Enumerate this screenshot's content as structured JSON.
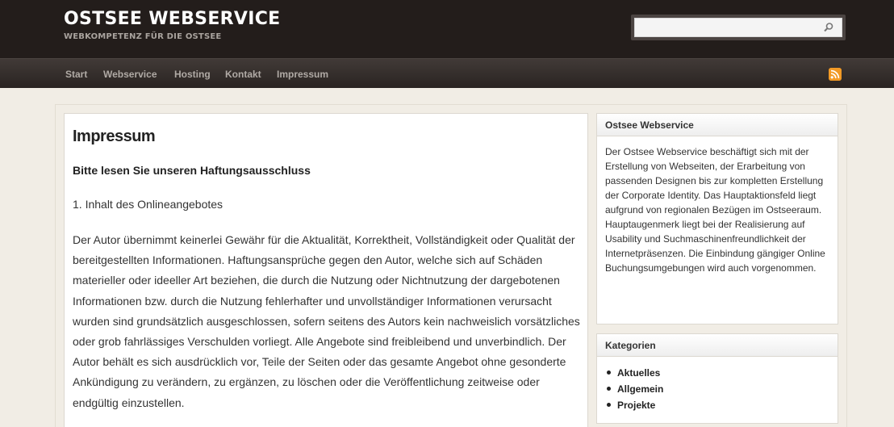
{
  "header": {
    "site_title": "OSTSEE WEBSERVICE",
    "site_description": "WEBKOMPETENZ FÜR DIE OSTSEE",
    "search": {
      "value": "",
      "placeholder": "",
      "icon": "search-icon"
    }
  },
  "nav": {
    "items": [
      {
        "label": "Start"
      },
      {
        "label": "Webservice"
      },
      {
        "label": "Hosting"
      },
      {
        "label": "Kontakt"
      },
      {
        "label": "Impressum"
      }
    ],
    "rss_icon": "rss-icon",
    "rss_color": "#f29a26"
  },
  "main": {
    "title": "Impressum",
    "lead": "Bitte lesen Sie unseren Haftungsausschluss",
    "section_heading": "1. Inhalt des Onlineangebotes",
    "paragraph": "Der Autor übernimmt keinerlei Gewähr für die Aktualität, Korrektheit, Vollständigkeit oder Qualität der bereitgestellten Informationen. Haftungsansprüche gegen den Autor, welche sich auf Schäden materieller oder ideeller Art beziehen, die durch die Nutzung oder Nichtnutzung der dargebotenen Informationen bzw. durch die Nutzung fehlerhafter und unvollständiger Informationen verursacht wurden sind grundsätzlich ausgeschlossen, sofern seitens des Autors kein nachweislich vorsätzliches oder grob fahrlässiges Verschulden vorliegt. Alle Angebote sind freibleibend und unverbindlich. Der Autor behält es sich ausdrücklich vor, Teile der Seiten oder das gesamte Angebot ohne gesonderte Ankündigung zu verändern, zu ergänzen, zu löschen oder die Veröffentlichung zeitweise oder endgültig einzustellen."
  },
  "sidebar": {
    "about": {
      "title": "Ostsee Webservice",
      "text": "Der Ostsee Webservice beschäftigt sich mit der Erstellung von Webseiten, der Erarbeitung von passenden Designen bis zur kompletten Erstellung der Corporate Identity. Das Hauptaktionsfeld liegt aufgrund von regionalen Bezügen im Ostseeraum. Hauptaugenmerk liegt bei der Realisierung auf Usability und Suchmaschinenfreundlichkeit der Internetpräsenzen. Die Einbindung gängiger Online Buchungsumgebungen wird auch vorgenommen."
    },
    "categories": {
      "title": "Kategorien",
      "items": [
        {
          "label": "Aktuelles"
        },
        {
          "label": "Allgemein"
        },
        {
          "label": "Projekte"
        }
      ]
    }
  }
}
